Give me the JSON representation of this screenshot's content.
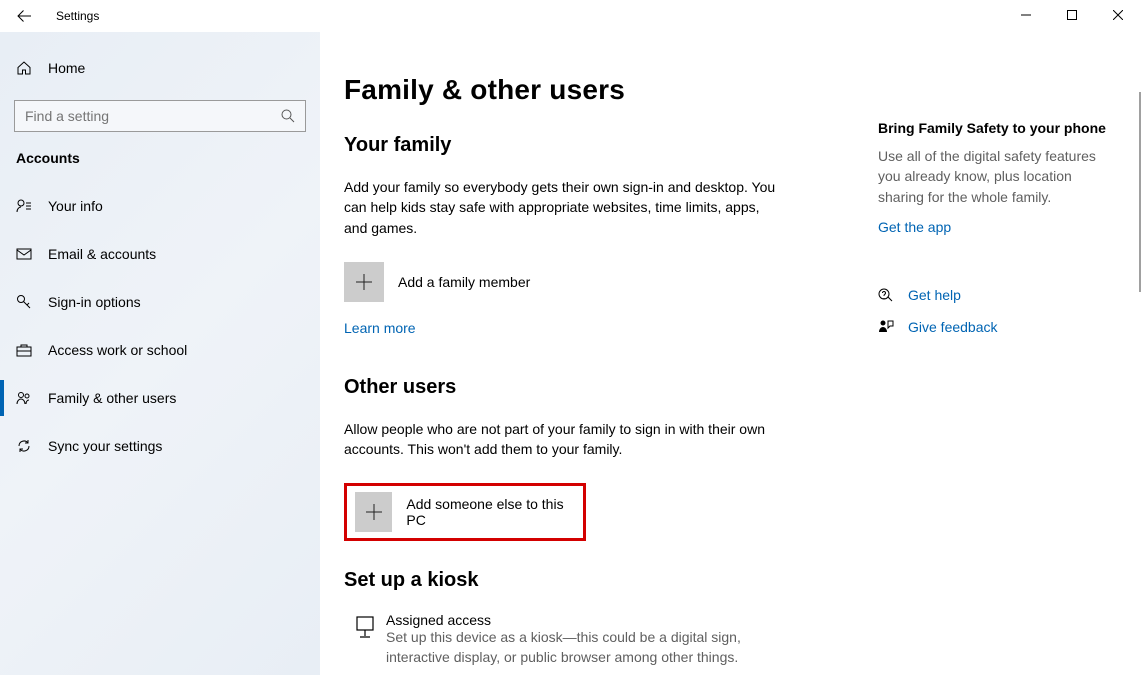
{
  "titlebar": {
    "title": "Settings"
  },
  "sidebar": {
    "home_label": "Home",
    "search_placeholder": "Find a setting",
    "category": "Accounts",
    "items": [
      {
        "label": "Your info",
        "icon": "user"
      },
      {
        "label": "Email & accounts",
        "icon": "mail"
      },
      {
        "label": "Sign-in options",
        "icon": "key"
      },
      {
        "label": "Access work or school",
        "icon": "briefcase"
      },
      {
        "label": "Family & other users",
        "icon": "people",
        "active": true
      },
      {
        "label": "Sync your settings",
        "icon": "sync"
      }
    ]
  },
  "content": {
    "page_title": "Family & other users",
    "sections": {
      "family": {
        "heading": "Your family",
        "description": "Add your family so everybody gets their own sign-in and desktop. You can help kids stay safe with appropriate websites, time limits, apps, and games.",
        "add_label": "Add a family member",
        "learn_more": "Learn more"
      },
      "other": {
        "heading": "Other users",
        "description": "Allow people who are not part of your family to sign in with their own accounts. This won't add them to your family.",
        "add_label": "Add someone else to this PC"
      },
      "kiosk": {
        "heading": "Set up a kiosk",
        "item_title": "Assigned access",
        "item_desc": "Set up this device as a kiosk—this could be a digital sign, interactive display, or public browser among other things."
      }
    },
    "side": {
      "promo_heading": "Bring Family Safety to your phone",
      "promo_desc": "Use all of the digital safety features you already know, plus location sharing for the whole family.",
      "promo_link": "Get the app",
      "help_label": "Get help",
      "feedback_label": "Give feedback"
    }
  }
}
